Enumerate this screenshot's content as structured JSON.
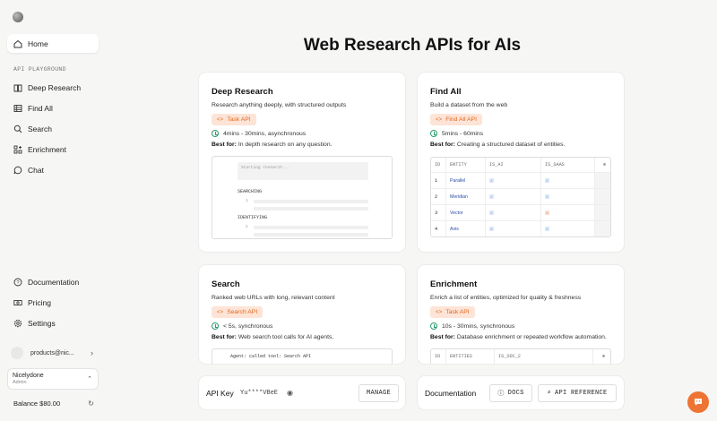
{
  "sidebar": {
    "home": "Home",
    "section": "API PLAYGROUND",
    "items": [
      {
        "label": "Deep Research",
        "icon": "book-icon"
      },
      {
        "label": "Find All",
        "icon": "table-icon"
      },
      {
        "label": "Search",
        "icon": "search-icon"
      },
      {
        "label": "Enrichment",
        "icon": "grid-plus-icon"
      },
      {
        "label": "Chat",
        "icon": "chat-icon"
      }
    ],
    "bottom": [
      {
        "label": "Documentation",
        "icon": "help-icon"
      },
      {
        "label": "Pricing",
        "icon": "money-icon"
      },
      {
        "label": "Settings",
        "icon": "gear-icon"
      }
    ],
    "account_email": "products@nic...",
    "org_name": "Nicelydone",
    "org_role": "Admin",
    "balance": "Balance $80.00"
  },
  "page_title": "Web Research APIs for AIs",
  "cards": {
    "deep_research": {
      "title": "Deep Research",
      "desc": "Research anything deeply, with structured outputs",
      "pill": "Task API",
      "time": "4mins - 30mins, asynchronous",
      "best_label": "Best for:",
      "best": " In depth research on any question.",
      "preview": {
        "input": "Starting research...",
        "step1": "SEARCHING",
        "n1": "1",
        "step2": "IDENTIFYING",
        "n2": "2"
      }
    },
    "find_all": {
      "title": "Find All",
      "desc": "Build a dataset from the web",
      "pill": "Find All API",
      "time": "5mins - 60mins",
      "best_label": "Best for:",
      "best": " Creating a structured dataset of entities.",
      "table": {
        "headers": [
          "ID",
          "ENTITY",
          "IS_AI",
          "IS_SAAS"
        ],
        "rows": [
          {
            "id": "1",
            "entity": "Parallel",
            "is_ai": "✓",
            "is_saas": "✓"
          },
          {
            "id": "2",
            "entity": "Meridian",
            "is_ai": "✓",
            "is_saas": "✓"
          },
          {
            "id": "3",
            "entity": "Vector",
            "is_ai": "✓",
            "is_saas": "✕"
          },
          {
            "id": "4",
            "entity": "Axis",
            "is_ai": "✓",
            "is_saas": "✓"
          }
        ]
      }
    },
    "search": {
      "title": "Search",
      "desc": "Ranked web URLs with long, relevant content",
      "pill": "Search API",
      "time": "< 5s, synchronous",
      "best_label": "Best for:",
      "best": " Web search tool calls for AI agents.",
      "preview": "Agent: called tool: Search API"
    },
    "enrichment": {
      "title": "Enrichment",
      "desc": "Enrich a list of entities, optimized for quality & freshness",
      "pill": "Task API",
      "time": "10s - 30mins, synchronous",
      "best_label": "Best for:",
      "best": " Database enrichment or repeated workflow automation.",
      "table_headers": [
        "ID",
        "ENTITIES",
        "IS_SOC_2"
      ]
    }
  },
  "api_key": {
    "label": "API Key",
    "value": "Yu****VBeE",
    "manage": "MANAGE"
  },
  "docs": {
    "label": "Documentation",
    "docs_btn": "DOCS",
    "api_ref_btn": "API REFERENCE"
  },
  "colors": {
    "accent": "#ee7433",
    "pill_bg": "#fde4d6",
    "success": "#2a9d6e"
  }
}
